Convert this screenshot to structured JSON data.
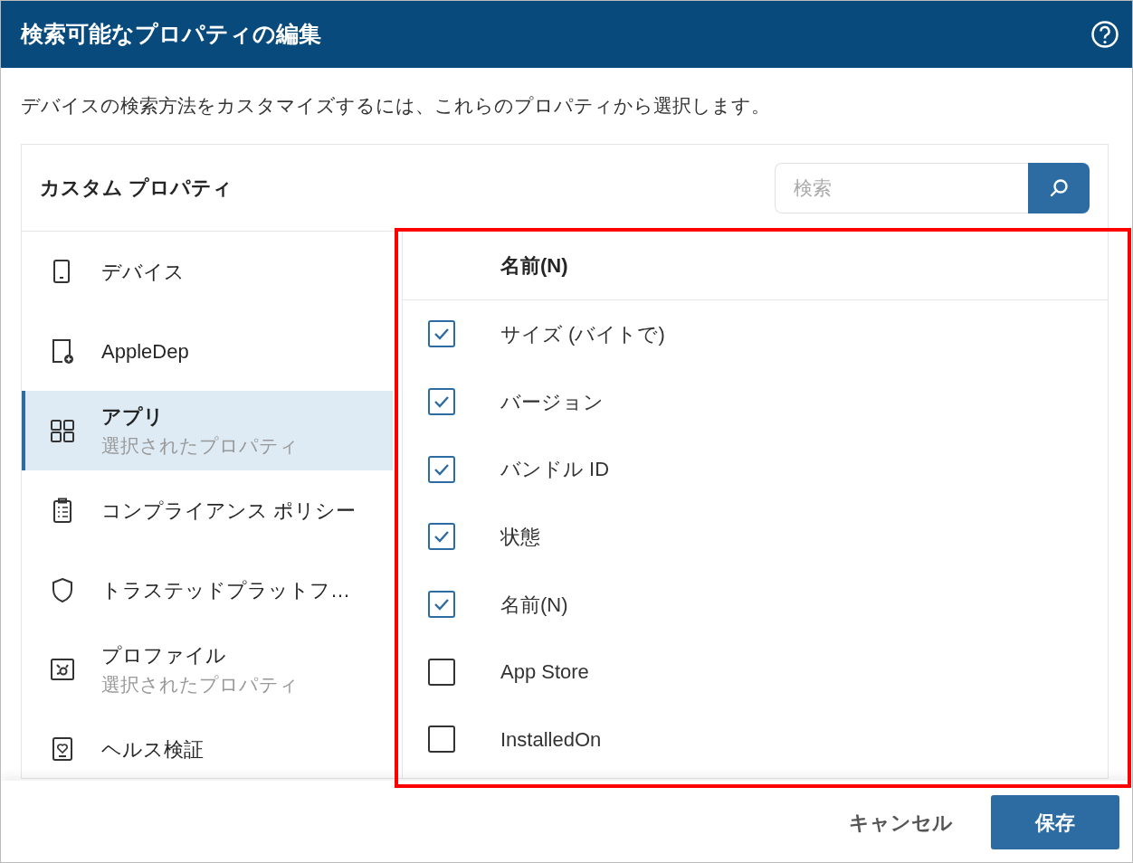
{
  "window": {
    "title": "検索可能なプロパティの編集"
  },
  "description": "デバイスの検索方法をカスタマイズするには、これらのプロパティから選択します。",
  "panel": {
    "title": "カスタム プロパティ",
    "search": {
      "placeholder": "検索"
    }
  },
  "sidebar": {
    "items": [
      {
        "label": "デバイス",
        "selected": false
      },
      {
        "label": "AppleDep",
        "selected": false
      },
      {
        "label": "アプリ",
        "sublabel": "選択されたプロパティ",
        "selected": true
      },
      {
        "label": "コンプライアンス ポリシー",
        "selected": false
      },
      {
        "label": "トラステッドプラットフ…",
        "selected": false
      },
      {
        "label": "プロファイル",
        "sublabel": "選択されたプロパティ",
        "selected": false
      },
      {
        "label": "ヘルス検証",
        "selected": false
      }
    ]
  },
  "table": {
    "columns": [
      "名前(N)"
    ],
    "rows": [
      {
        "label": "サイズ (バイトで)",
        "checked": true
      },
      {
        "label": "バージョン",
        "checked": true
      },
      {
        "label": "バンドル ID",
        "checked": true
      },
      {
        "label": "状態",
        "checked": true
      },
      {
        "label": "名前(N)",
        "checked": true
      },
      {
        "label": "App Store",
        "checked": false
      },
      {
        "label": "InstalledOn",
        "checked": false
      }
    ]
  },
  "buttons": [
    {
      "kind": "secondary",
      "label": "キャンセル"
    },
    {
      "kind": "primary",
      "label": "保存"
    }
  ]
}
